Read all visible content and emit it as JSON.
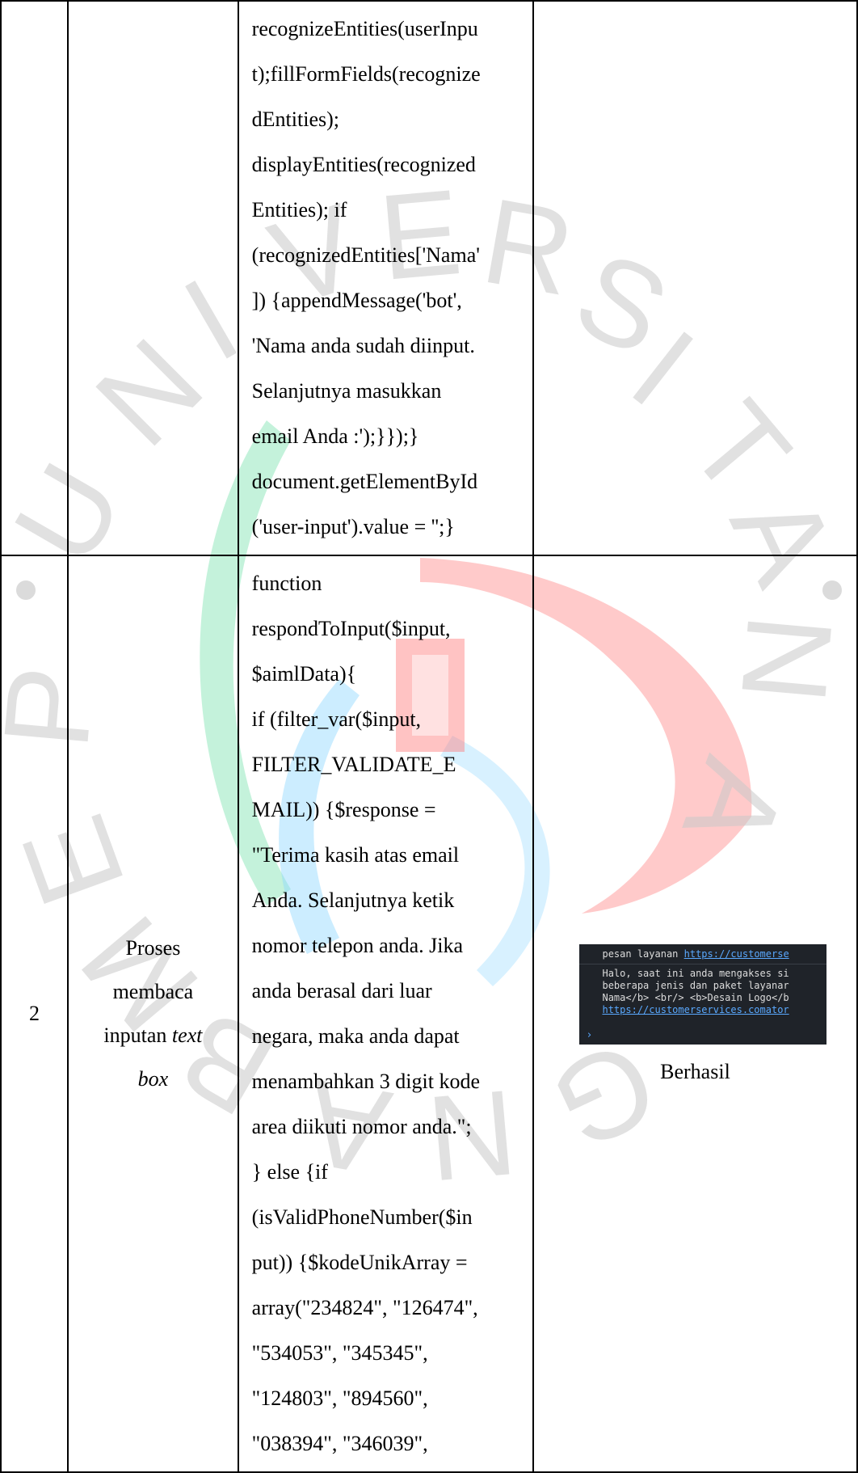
{
  "watermark": {
    "letters": [
      "U",
      "N",
      "I",
      "V",
      "E",
      "R",
      "S",
      "I",
      "T",
      "A",
      "S",
      "P",
      "E",
      "M",
      "B",
      "A",
      "N",
      "G",
      "U",
      "N",
      "A",
      "N"
    ]
  },
  "rows": [
    {
      "code_lines": [
        "recognizeEntities(userInpu",
        "t);fillFormFields(recognize",
        "dEntities);",
        "displayEntities(recognized",
        "Entities); if",
        "(recognizedEntities['Nama'",
        "]) {appendMessage('bot',",
        "'Nama anda sudah diinput.",
        "Selanjutnya masukkan",
        "email Anda :');}});}",
        "document.getElementById",
        "('user-input').value = '';}"
      ]
    },
    {
      "number": "2",
      "name_line1": "Proses",
      "name_line2": "membaca",
      "name_line3_plain": "inputan ",
      "name_line3_italic": "text",
      "name_line4_italic": "box",
      "code_lines": [
        "function",
        "respondToInput($input,",
        "$aimlData){",
        "if (filter_var($input,",
        "FILTER_VALIDATE_E",
        "MAIL)) {$response =",
        "\"Terima kasih atas email",
        "Anda. Selanjutnya ketik",
        "nomor telepon anda. Jika",
        "anda berasal dari luar",
        "negara, maka anda dapat",
        "menambahkan 3 digit kode",
        "area diikuti nomor anda.\";",
        "} else {if",
        "(isValidPhoneNumber($in",
        "put)) {$kodeUnikArray =",
        "array(\"234824\", \"126474\",",
        "\"534053\", \"345345\",",
        "\"124803\", \"894560\",",
        "\"038394\", \"346039\","
      ],
      "console": {
        "line1_text": "pesan layanan ",
        "line1_link": "https://customerse",
        "line2": "Halo, saat ini anda mengakses si",
        "line3": "beberapa jenis dan paket layanar",
        "line4": "Nama</b> <br/> <b>Desain Logo</b",
        "line5_link": "https://customerservices.comator",
        "prompt": "›"
      },
      "result_status": "Berhasil"
    }
  ]
}
